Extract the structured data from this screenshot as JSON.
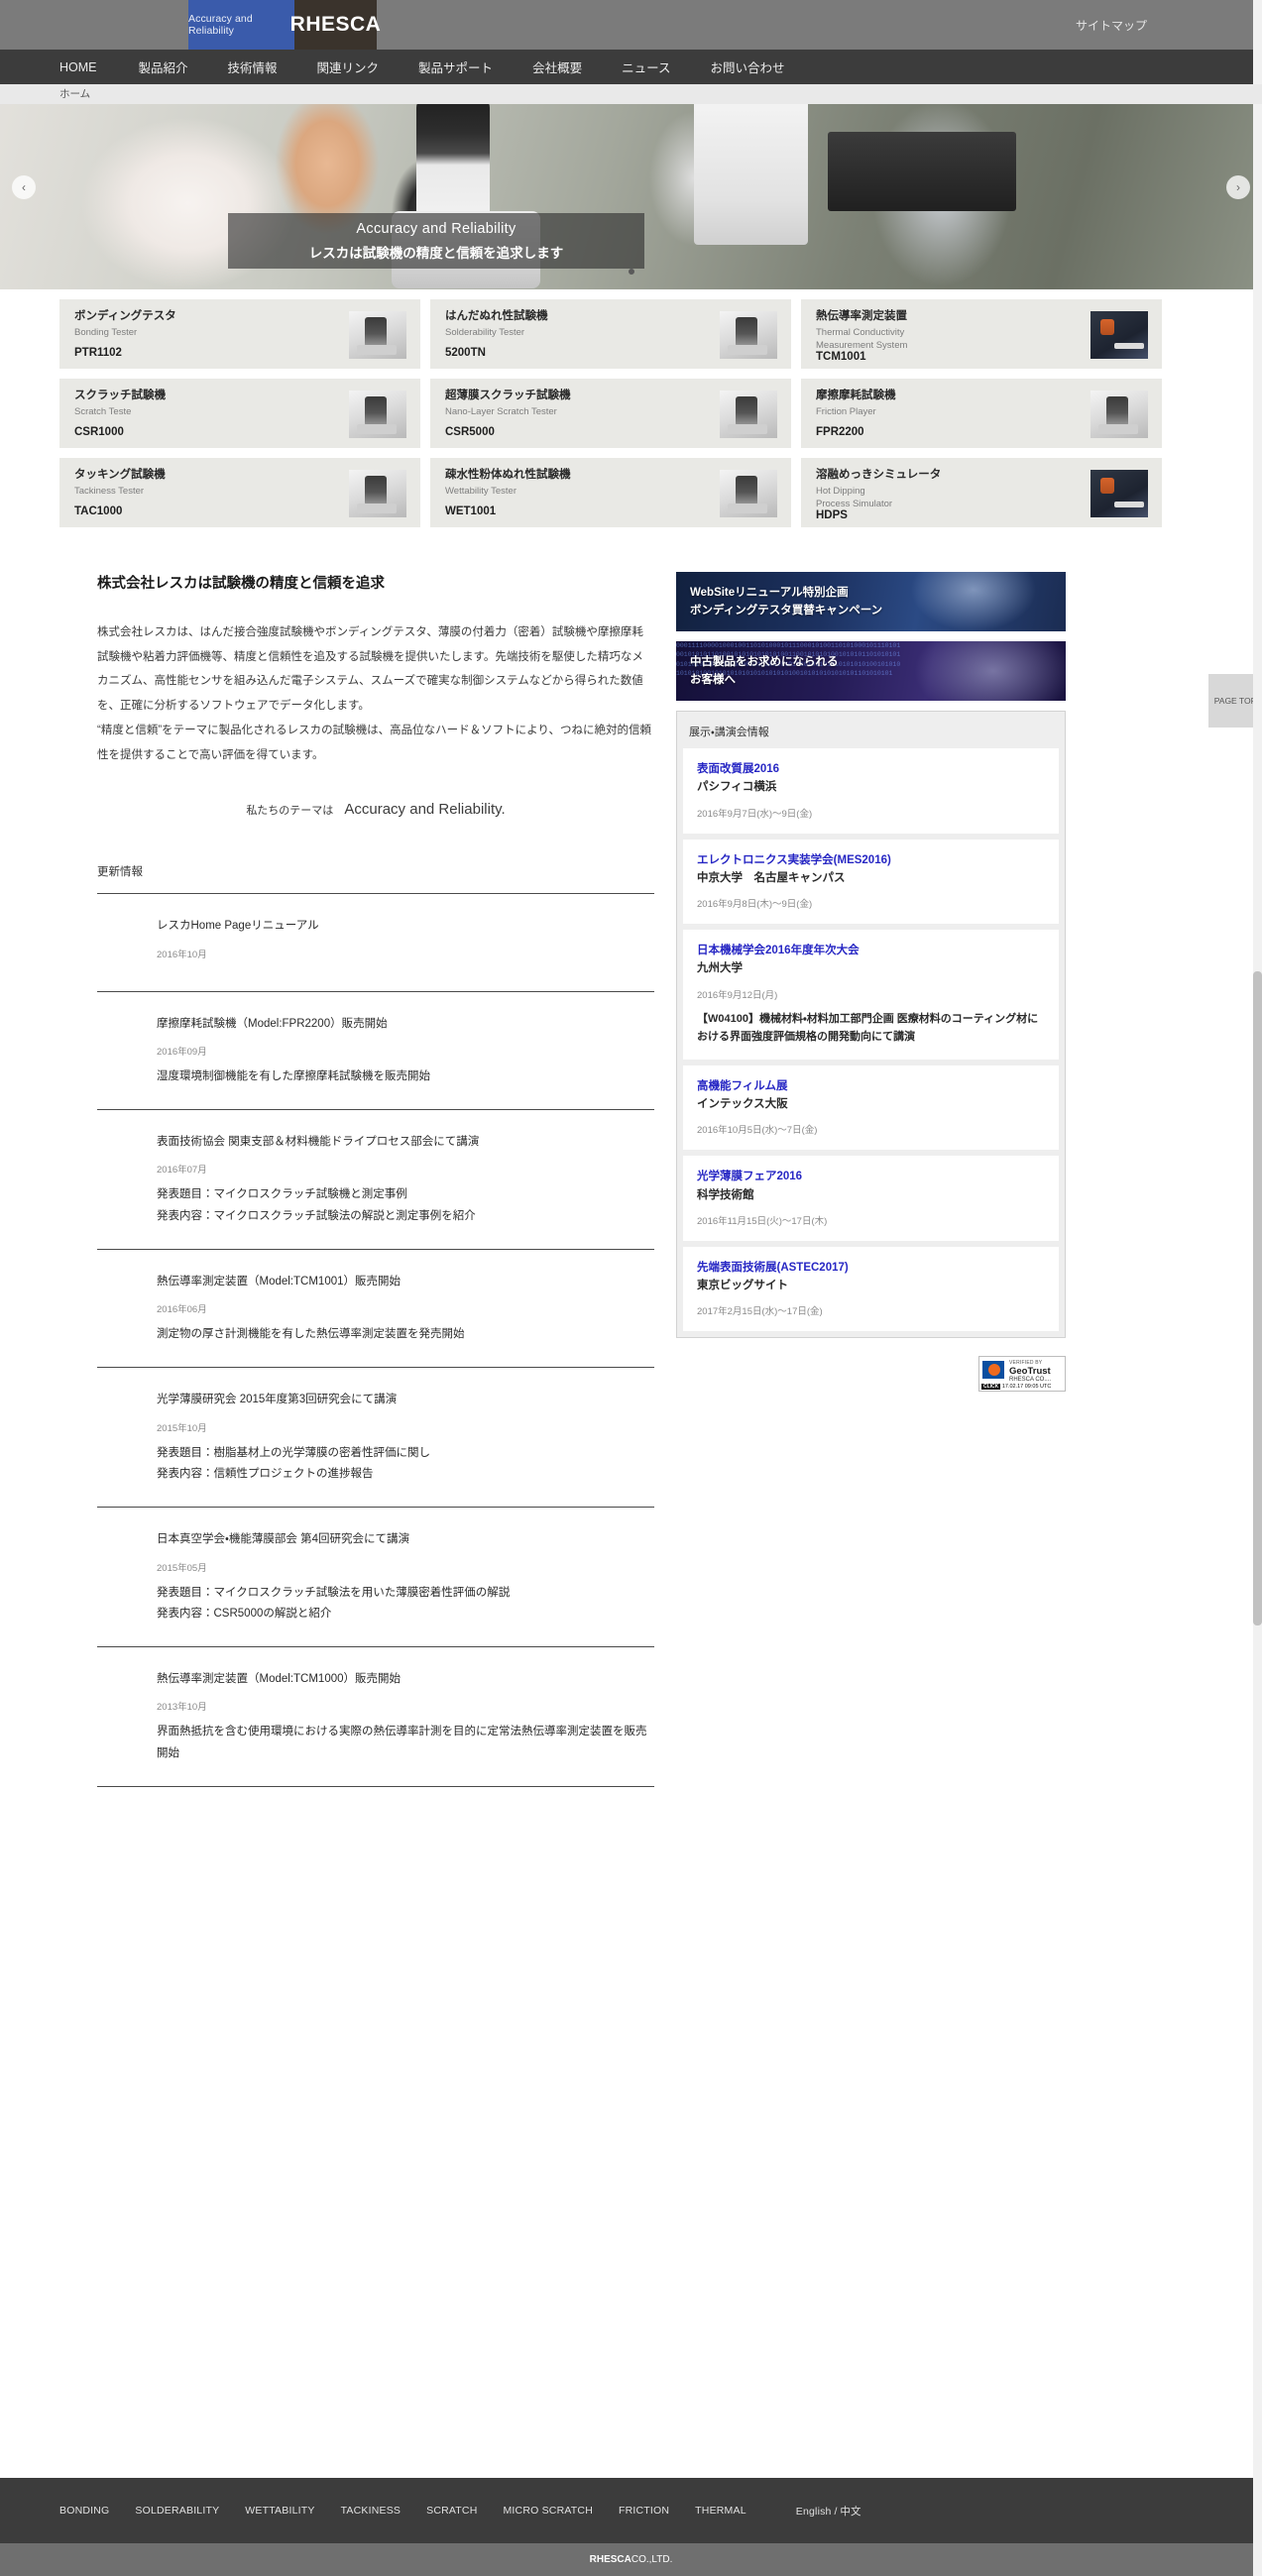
{
  "header": {
    "logo_tagline": "Accuracy and Reliability",
    "logo_mark": "RHESCA",
    "sitemap_label": "サイトマップ",
    "nav": [
      {
        "label": "HOME"
      },
      {
        "label": "製品紹介"
      },
      {
        "label": "技術情報"
      },
      {
        "label": "関連リンク"
      },
      {
        "label": "製品サポート"
      },
      {
        "label": "会社概要"
      },
      {
        "label": "ニュース"
      },
      {
        "label": "お問い合わせ"
      }
    ],
    "breadcrumb": "ホーム"
  },
  "hero": {
    "caption_en": "Accuracy and Reliability",
    "caption_jp": "レスカは試験機の精度と信頼を追求します",
    "prev_arrow": "‹",
    "next_arrow": "›"
  },
  "page_top_label": "PAGE TOP",
  "products": [
    {
      "jp": "ボンディングテスタ",
      "en": "Bonding Tester",
      "model": "PTR1102"
    },
    {
      "jp": "はんだぬれ性試験機",
      "en": "Solderability Tester",
      "model": "5200TN"
    },
    {
      "jp": "熱伝導率測定装置",
      "en": "Thermal Conductivity\nMeasurement System",
      "model": "TCM1001"
    },
    {
      "jp": "スクラッチ試験機",
      "en": "Scratch Teste",
      "model": "CSR1000"
    },
    {
      "jp": "超薄膜スクラッチ試験機",
      "en": "Nano-Layer Scratch Tester",
      "model": "CSR5000"
    },
    {
      "jp": "摩擦摩耗試験機",
      "en": "Friction Player",
      "model": "FPR2200"
    },
    {
      "jp": "タッキング試験機",
      "en": "Tackiness Tester",
      "model": "TAC1000"
    },
    {
      "jp": "疎水性粉体ぬれ性試験機",
      "en": "Wettability Tester",
      "model": "WET1001"
    },
    {
      "jp": "溶融めっきシミュレータ",
      "en": "Hot Dipping\nProcess Simulator",
      "model": "HDPS"
    }
  ],
  "main": {
    "lead_title": "株式会社レスカは試験機の精度と信頼を追求",
    "lead_body_1": "株式会社レスカは、はんだ接合強度試験機やボンディングテスタ、薄膜の付着力（密着）試験機や摩擦摩耗試験機や粘着力評価機等、精度と信頼性を追及する試験機を提供いたします。先端技術を駆使した精巧なメカニズム、高性能センサを組み込んだ電子システム、スムーズで確実な制御システムなどから得られた数値を、正確に分析するソフトウェアでデータ化します。",
    "lead_body_2": "“精度と信頼”をテーマに製品化されるレスカの試験機は、高品位なハード＆ソフトにより、つねに絶対的信頼性を提供することで高い評価を得ています。",
    "theme_prefix": "私たちのテーマは",
    "theme_value": "Accuracy and Reliability.",
    "news_head": "更新情報"
  },
  "news": [
    {
      "title": "レスカHome Pageリニューアル",
      "date": "2016年10月",
      "lines": []
    },
    {
      "title": "摩擦摩耗試験機（Model:FPR2200）販売開始",
      "date": "2016年09月",
      "lines": [
        "湿度環境制御機能を有した摩擦摩耗試験機を販売開始"
      ]
    },
    {
      "title": "表面技術協会 関東支部＆材料機能ドライプロセス部会にて講演",
      "date": "2016年07月",
      "lines": [
        "発表題目：マイクロスクラッチ試験機と測定事例",
        "発表内容：マイクロスクラッチ試験法の解説と測定事例を紹介"
      ]
    },
    {
      "title": "熱伝導率測定装置（Model:TCM1001）販売開始",
      "date": "2016年06月",
      "lines": [
        "測定物の厚さ計測機能を有した熱伝導率測定装置を発売開始"
      ]
    },
    {
      "title": "光学薄膜研究会 2015年度第3回研究会にて講演",
      "date": "2015年10月",
      "lines": [
        "発表題目：樹脂基材上の光学薄膜の密着性評価に関し",
        "発表内容：信頼性プロジェクトの進捗報告"
      ]
    },
    {
      "title": "日本真空学会・機能薄膜部会 第4回研究会にて講演",
      "date": "2015年05月",
      "lines": [
        "発表題目：マイクロスクラッチ試験法を用いた薄膜密着性評価の解説",
        "発表内容：CSR5000の解説と紹介"
      ]
    },
    {
      "title": "熱伝導率測定装置（Model:TCM1000）販売開始",
      "date": "2013年10月",
      "lines": [
        "界面熱抵抗を含む使用環境における実際の熱伝導率計測を目的に定常法熱伝導率測定装置を販売開始"
      ]
    }
  ],
  "sidebar": {
    "banner1_line1": "WebSiteリニューアル特別企画",
    "banner1_line2": "ボンディングテスタ買替キャンペーン",
    "banner2_line1": "中古製品をお求めになられる",
    "banner2_line2": "お客様へ",
    "banner2_bits": "00011110000100010011010100010111000101001101010001011101010010101011010010101010101010011001010101001010101101010101010101001010101010010101011010101010110101010101010010101010101010010101010101010101010100101010101010101101010101",
    "events_head": "展示・講演会情報",
    "events": [
      {
        "title": "表面改質展2016",
        "place": "パシフィコ横浜",
        "date": "2016年9月7日(水)～9日(金)",
        "note": ""
      },
      {
        "title": "エレクトロニクス実装学会(MES2016)",
        "place": "中京大学　名古屋キャンパス",
        "date": "2016年9月8日(木)～9日(金)",
        "note": ""
      },
      {
        "title": "日本機械学会2016年度年次大会",
        "place": "九州大学",
        "date": "2016年9月12日(月)",
        "note": "【W04100】機械材料・材料加工部門企画 医療材料のコーティング材における界面強度評価規格の開発動向にて講演"
      },
      {
        "title": "高機能フィルム展",
        "place": "インテックス大阪",
        "date": "2016年10月5日(水)～7日(金)",
        "note": ""
      },
      {
        "title": "光学薄膜フェア2016",
        "place": "科学技術館",
        "date": "2016年11月15日(火)～17日(木)",
        "note": ""
      },
      {
        "title": "先端表面技術展(ASTEC2017)",
        "place": "東京ビッグサイト",
        "date": "2017年2月15日(水)～17日(金)",
        "note": ""
      }
    ],
    "geotrust": {
      "verified": "VERIFIED BY",
      "brand": "GeoTrust",
      "company": "RHESCA CO....",
      "click": "CLICK",
      "timestamp": "17.02.17 09:05 UTC"
    }
  },
  "footer": {
    "links": [
      {
        "label": "BONDING"
      },
      {
        "label": "SOLDERABILITY"
      },
      {
        "label": "WETTABILITY"
      },
      {
        "label": "TACKINESS"
      },
      {
        "label": "SCRATCH"
      },
      {
        "label": "MICRO SCRATCH"
      },
      {
        "label": "FRICTION"
      },
      {
        "label": "THERMAL"
      }
    ],
    "lang_en": "English",
    "lang_sep": "/",
    "lang_zh": "中文",
    "copyright_brand": "RHESCA",
    "copyright_rest": " CO.,LTD."
  },
  "colors": {
    "topbar": "#7b7b7b",
    "nav": "#3c3c3c",
    "accent_blue": "#3a5bab",
    "link_blue": "#2727c4",
    "card_bg": "#e9e9e5"
  }
}
